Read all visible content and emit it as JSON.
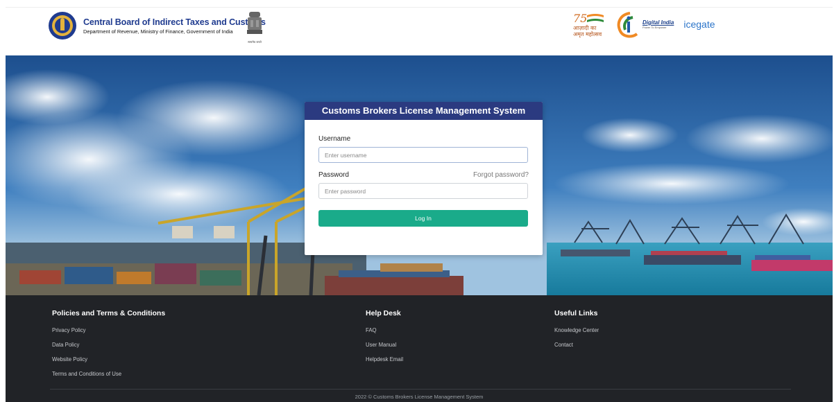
{
  "header": {
    "title": "Central Board of Indirect Taxes and Customs",
    "subtitle": "Department of Revenue, Ministry of Finance, Government of India",
    "emblem_caption": "सत्यमेव जयते",
    "logos": {
      "azadi": "आज़ादी का अमृत महोत्सव",
      "azadi_number": "75",
      "digital_india": "Digital India",
      "digital_india_tag": "Power To Empower",
      "icegate": "icegate"
    }
  },
  "login": {
    "title": "Customs Brokers License Management System",
    "username_label": "Username",
    "username_placeholder": "Enter username",
    "password_label": "Password",
    "password_placeholder": "Enter password",
    "forgot_label": "Forgot password?",
    "button_label": "Log In"
  },
  "footer": {
    "policies": {
      "heading": "Policies and Terms & Conditions",
      "links": [
        "Privacy Policy",
        "Data Policy",
        "Website Policy",
        "Terms and Conditions of Use"
      ]
    },
    "helpdesk": {
      "heading": "Help Desk",
      "links": [
        "FAQ",
        "User Manual",
        "Helpdesk Email"
      ]
    },
    "useful": {
      "heading": "Useful Links",
      "links": [
        "Knowledge Center",
        "Contact"
      ]
    },
    "copyright": "2022 © Customs Brokers License Management System"
  },
  "colors": {
    "brand_blue": "#1f3b8f",
    "card_header": "#2b3a80",
    "login_button": "#1aab8a",
    "footer_bg": "#212327"
  }
}
